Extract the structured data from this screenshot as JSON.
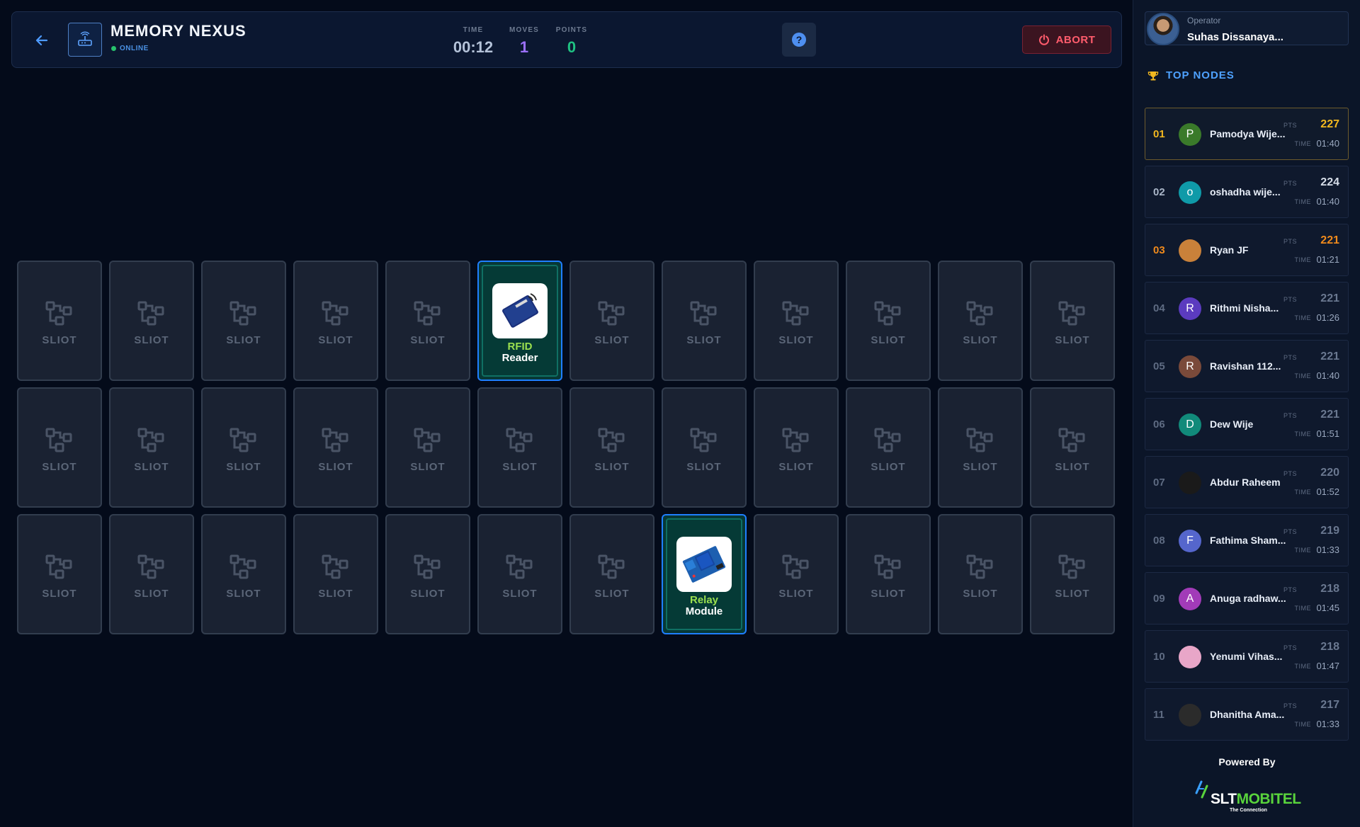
{
  "header": {
    "title": "MEMORY NEXUS",
    "status": "ONLINE",
    "stats": {
      "time_label": "TIME",
      "time_value": "00:12",
      "moves_label": "MOVES",
      "moves_value": "1",
      "points_label": "POINTS",
      "points_value": "0"
    },
    "help_icon": "?",
    "abort_label": "ABORT"
  },
  "board": {
    "slot_label": "SLIOT",
    "revealed": [
      {
        "row": 1,
        "col": 6,
        "line1": "RFID",
        "line2": "Reader",
        "icon": "rfid-card-icon"
      },
      {
        "row": 3,
        "col": 8,
        "line1": "Relay",
        "line2": "Module",
        "icon": "relay-module-icon"
      }
    ]
  },
  "sidebar": {
    "operator_label": "Operator",
    "operator_name": "Suhas Dissanaya...",
    "leaderboard_title": "TOP NODES",
    "pts_label": "PTS",
    "time_label": "TIME",
    "entries": [
      {
        "rank": "01",
        "initial": "P",
        "name": "Pamodya Wije...",
        "pts": "227",
        "time": "01:40",
        "avatar_color": "#3a7a2a",
        "rank_color": "#f2b81f",
        "pts_color": "#f2b81f"
      },
      {
        "rank": "02",
        "initial": "o",
        "name": "oshadha wije...",
        "pts": "224",
        "time": "01:40",
        "avatar_color": "#0f9aa8",
        "rank_color": "#aab6c8",
        "pts_color": "#d6dde8"
      },
      {
        "rank": "03",
        "initial": "",
        "name": "Ryan JF",
        "pts": "221",
        "time": "01:21",
        "avatar_color": "#c9813a",
        "rank_color": "#f08a1c",
        "pts_color": "#f08a1c"
      },
      {
        "rank": "04",
        "initial": "R",
        "name": "Rithmi Nisha...",
        "pts": "221",
        "time": "01:26",
        "avatar_color": "#5b3bbf",
        "rank_color": "#5e6b82",
        "pts_color": "#6a7890"
      },
      {
        "rank": "05",
        "initial": "R",
        "name": "Ravishan 112...",
        "pts": "221",
        "time": "01:40",
        "avatar_color": "#7a4a3a",
        "rank_color": "#5e6b82",
        "pts_color": "#6a7890"
      },
      {
        "rank": "06",
        "initial": "D",
        "name": "Dew Wije",
        "pts": "221",
        "time": "01:51",
        "avatar_color": "#118a7a",
        "rank_color": "#5e6b82",
        "pts_color": "#6a7890"
      },
      {
        "rank": "07",
        "initial": "",
        "name": "Abdur Raheem",
        "pts": "220",
        "time": "01:52",
        "avatar_color": "#1a1a1a",
        "rank_color": "#5e6b82",
        "pts_color": "#6a7890"
      },
      {
        "rank": "08",
        "initial": "F",
        "name": "Fathima Sham...",
        "pts": "219",
        "time": "01:33",
        "avatar_color": "#5566cc",
        "rank_color": "#5e6b82",
        "pts_color": "#6a7890"
      },
      {
        "rank": "09",
        "initial": "A",
        "name": "Anuga radhaw...",
        "pts": "218",
        "time": "01:45",
        "avatar_color": "#a23bb8",
        "rank_color": "#5e6b82",
        "pts_color": "#6a7890"
      },
      {
        "rank": "10",
        "initial": "",
        "name": "Yenumi Vihas...",
        "pts": "218",
        "time": "01:47",
        "avatar_color": "#e8a6c8",
        "rank_color": "#5e6b82",
        "pts_color": "#6a7890"
      },
      {
        "rank": "11",
        "initial": "",
        "name": "Dhanitha Ama...",
        "pts": "217",
        "time": "01:33",
        "avatar_color": "#2b2b2b",
        "rank_color": "#5e6b82",
        "pts_color": "#6a7890"
      }
    ],
    "powered_by": "Powered By",
    "brand_a": "SLT",
    "brand_b": "MOBITEL",
    "brand_tagline": "The Connection"
  }
}
